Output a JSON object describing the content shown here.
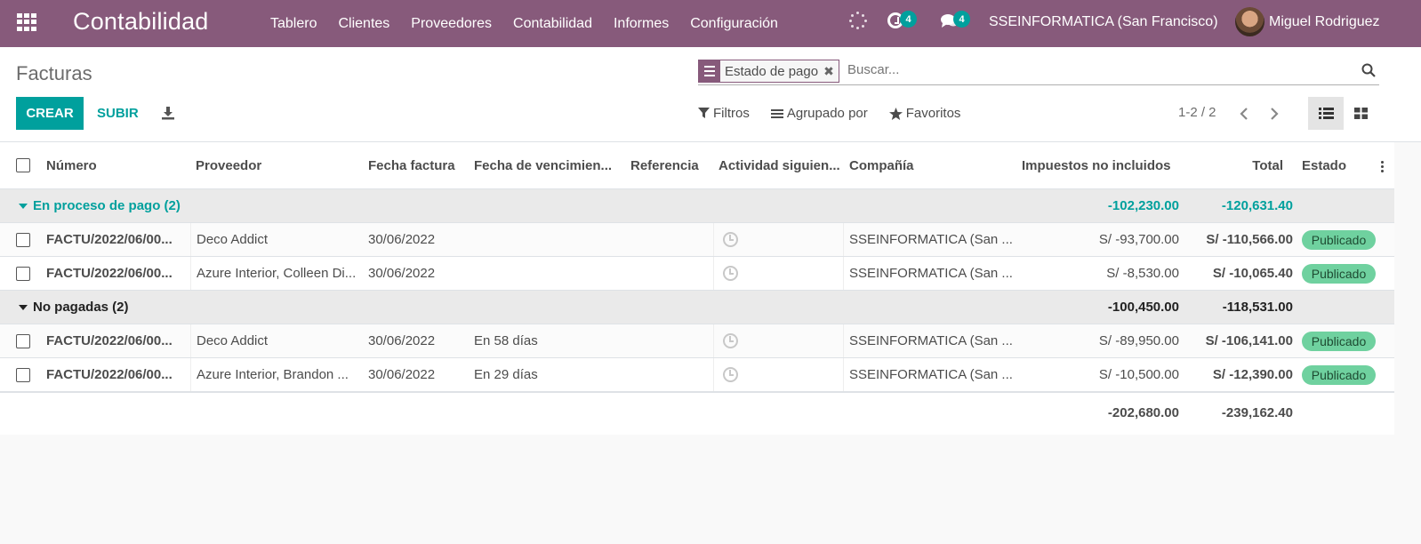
{
  "navbar": {
    "brand": "Contabilidad",
    "menu": [
      "Tablero",
      "Clientes",
      "Proveedores",
      "Contabilidad",
      "Informes",
      "Configuración"
    ],
    "activity_count": "4",
    "messages_count": "4",
    "company": "SSEINFORMATICA (San Francisco)",
    "user": "Miguel Rodriguez"
  },
  "control": {
    "breadcrumb": "Facturas",
    "facet_label": "Estado de pago",
    "search_placeholder": "Buscar...",
    "create_label": "CREAR",
    "upload_label": "SUBIR",
    "filters_label": "Filtros",
    "groupby_label": "Agrupado por",
    "favorites_label": "Favoritos",
    "pager": "1-2 / 2"
  },
  "table": {
    "headers": {
      "number": "Número",
      "vendor": "Proveedor",
      "invoice_date": "Fecha factura",
      "due_date": "Fecha de vencimien...",
      "reference": "Referencia",
      "next_activity": "Actividad siguien...",
      "company": "Compañía",
      "untaxed": "Impuestos no incluidos",
      "total": "Total",
      "status": "Estado"
    },
    "groups": [
      {
        "label": "En proceso de pago (2)",
        "untaxed": "-102,230.00",
        "total": "-120,631.40",
        "rows": [
          {
            "number": "FACTU/2022/06/00...",
            "vendor": "Deco Addict",
            "invoice_date": "30/06/2022",
            "due_date": "",
            "reference": "",
            "company": "SSEINFORMATICA (San ...",
            "untaxed": "S/ -93,700.00",
            "total": "S/ -110,566.00",
            "status": "Publicado"
          },
          {
            "number": "FACTU/2022/06/00...",
            "vendor": "Azure Interior, Colleen Di...",
            "invoice_date": "30/06/2022",
            "due_date": "",
            "reference": "",
            "company": "SSEINFORMATICA (San ...",
            "untaxed": "S/ -8,530.00",
            "total": "S/ -10,065.40",
            "status": "Publicado"
          }
        ]
      },
      {
        "label": "No pagadas (2)",
        "untaxed": "-100,450.00",
        "total": "-118,531.00",
        "rows": [
          {
            "number": "FACTU/2022/06/00...",
            "vendor": "Deco Addict",
            "invoice_date": "30/06/2022",
            "due_date": "En 58 días",
            "reference": "",
            "company": "SSEINFORMATICA (San ...",
            "untaxed": "S/ -89,950.00",
            "total": "S/ -106,141.00",
            "status": "Publicado"
          },
          {
            "number": "FACTU/2022/06/00...",
            "vendor": "Azure Interior, Brandon ...",
            "invoice_date": "30/06/2022",
            "due_date": "En 29 días",
            "reference": "",
            "company": "SSEINFORMATICA (San ...",
            "untaxed": "S/ -10,500.00",
            "total": "S/ -12,390.00",
            "status": "Publicado"
          }
        ]
      }
    ],
    "footer": {
      "untaxed": "-202,680.00",
      "total": "-239,162.40"
    }
  },
  "colors": {
    "brand": "#875a7b",
    "accent": "#00a09d",
    "status_posted": "#6fd19f"
  }
}
